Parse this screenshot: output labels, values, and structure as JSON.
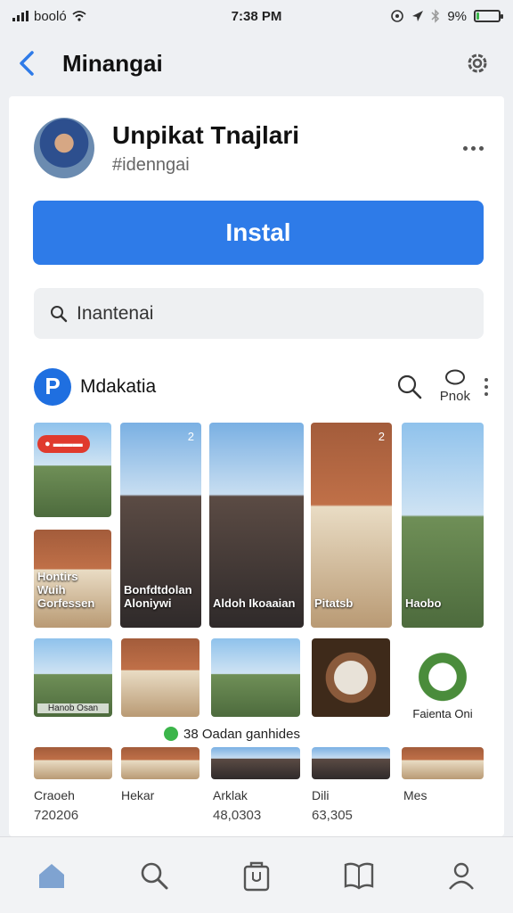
{
  "status_bar": {
    "carrier": "booló",
    "time": "7:38 PM",
    "battery": "9%",
    "battery_level": 0.09
  },
  "header": {
    "title": "Minangai"
  },
  "profile": {
    "name": "Unpikat Tnajlari",
    "handle": "#idenngai"
  },
  "install": {
    "label": "Instal"
  },
  "search": {
    "text": "Inantenai"
  },
  "section": {
    "logo_letter": "P",
    "title": "Mdakatia",
    "action_label": "Pnok"
  },
  "tiles_row1": [
    {
      "caption": "Hontirs Wuih Gorfessen",
      "badge": ""
    },
    {
      "caption": "Bonfdtdolan Aloniywi",
      "badge": "2"
    },
    {
      "caption": "Aldoh Ikoaaian",
      "badge": ""
    },
    {
      "caption": "Pitatsb",
      "badge": "2"
    },
    {
      "caption": "Haobo",
      "badge": ""
    }
  ],
  "tiles_row2": [
    {
      "caption": "Hanob Osan"
    },
    {
      "caption": ""
    },
    {
      "caption": ""
    },
    {
      "caption": ""
    },
    {
      "caption": "Faienta Oni"
    }
  ],
  "mid_label": "38 Oadan ganhides",
  "bottom_cells": [
    {
      "name": "Craoeh",
      "count": "720206"
    },
    {
      "name": "Hekar",
      "count": ""
    },
    {
      "name": "Arklak",
      "count": "48,0303"
    },
    {
      "name": "Dili",
      "count": "63,305"
    },
    {
      "name": "Mes",
      "count": ""
    }
  ],
  "tabbar": [
    "home-icon",
    "search-icon",
    "bag-icon",
    "book-icon",
    "profile-icon"
  ],
  "colors": {
    "accent": "#2e7be8",
    "battery": "#3bb54a",
    "badge": "#e03a2e"
  }
}
